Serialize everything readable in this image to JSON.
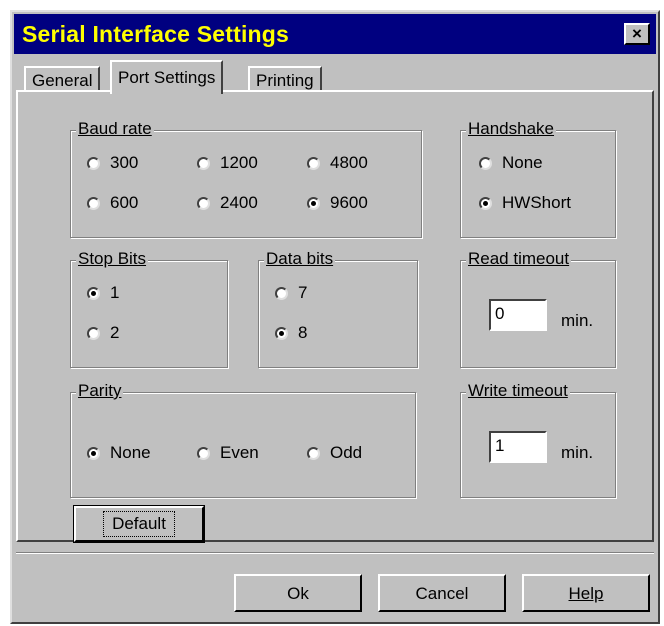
{
  "window": {
    "title": "Serial Interface Settings",
    "close_label": "×"
  },
  "tabs": [
    {
      "label": "General",
      "active": false
    },
    {
      "label": "Port Settings",
      "active": true
    },
    {
      "label": "Printing",
      "active": false
    }
  ],
  "baud_rate": {
    "label": "Baud rate",
    "options": [
      "300",
      "1200",
      "4800",
      "600",
      "2400",
      "9600"
    ],
    "selected": "9600"
  },
  "handshake": {
    "label": "Handshake",
    "options": [
      "None",
      "HWShort"
    ],
    "selected": "HWShort"
  },
  "stop_bits": {
    "label": "Stop Bits",
    "options": [
      "1",
      "2"
    ],
    "selected": "1"
  },
  "data_bits": {
    "label": "Data bits",
    "options": [
      "7",
      "8"
    ],
    "selected": "8"
  },
  "read_timeout": {
    "label": "Read timeout",
    "value": "0",
    "unit": "min."
  },
  "parity": {
    "label": "Parity",
    "options": [
      "None",
      "Even",
      "Odd"
    ],
    "selected": "None"
  },
  "write_timeout": {
    "label": "Write timeout",
    "value": "1",
    "unit": "min."
  },
  "buttons": {
    "default": "Default",
    "ok": "Ok",
    "cancel": "Cancel",
    "help": "Help"
  }
}
